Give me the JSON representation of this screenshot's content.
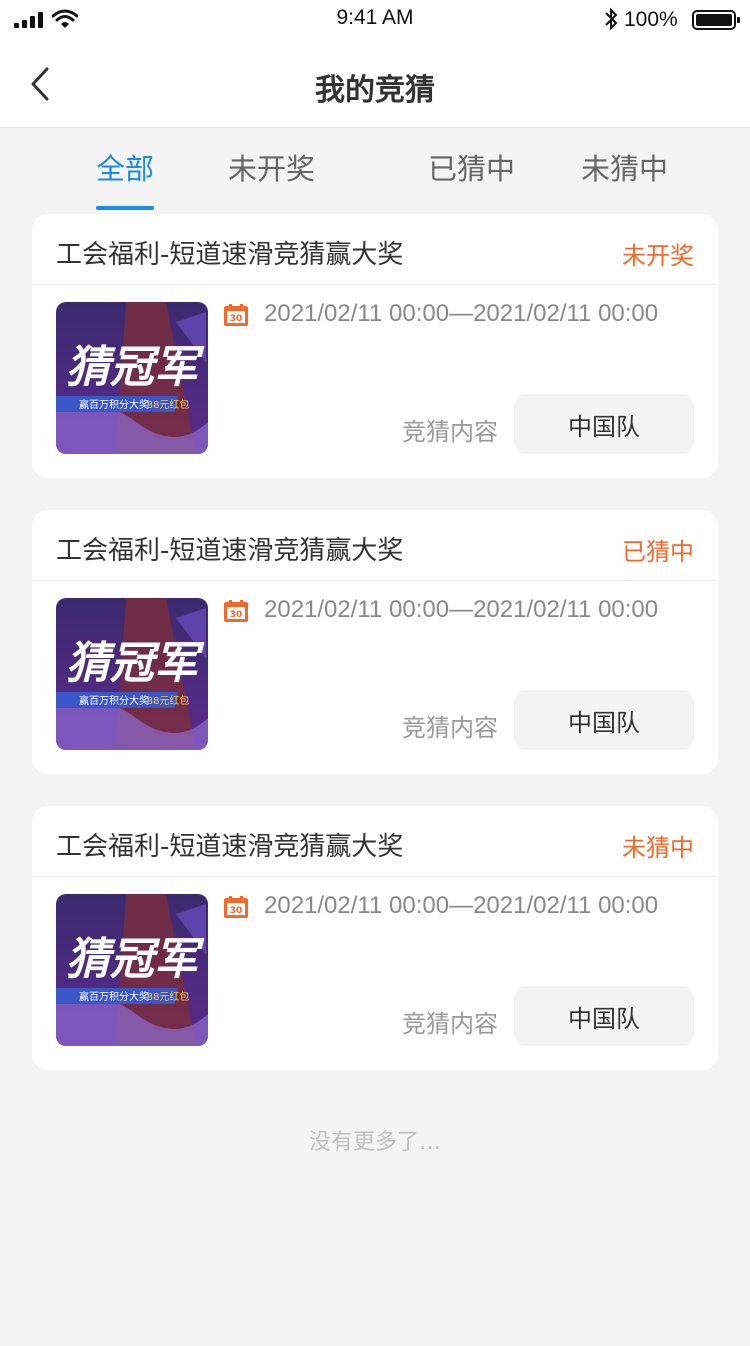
{
  "status_bar": {
    "time": "9:41 AM",
    "battery_percent": "100%"
  },
  "nav": {
    "title": "我的竞猜"
  },
  "tabs": [
    {
      "label": "全部",
      "active": true
    },
    {
      "label": "未开奖",
      "active": false
    },
    {
      "label": "已猜中",
      "active": false
    },
    {
      "label": "未猜中",
      "active": false
    }
  ],
  "cards": [
    {
      "title": "工会福利-短道速滑竞猜赢大奖",
      "status": "未开奖",
      "date_range": "2021/02/11 00:00—2021/02/11 00:00",
      "guess_label": "竞猜内容",
      "answer": "中国队",
      "calendar_day": "30",
      "thumb_title": "猜冠军",
      "thumb_banner": "赢百万积分大奖",
      "thumb_badge": "88元红包"
    },
    {
      "title": "工会福利-短道速滑竞猜赢大奖",
      "status": "已猜中",
      "date_range": "2021/02/11 00:00—2021/02/11 00:00",
      "guess_label": "竞猜内容",
      "answer": "中国队",
      "calendar_day": "30",
      "thumb_title": "猜冠军",
      "thumb_banner": "赢百万积分大奖",
      "thumb_badge": "88元红包"
    },
    {
      "title": "工会福利-短道速滑竞猜赢大奖",
      "status": "未猜中",
      "date_range": "2021/02/11 00:00—2021/02/11 00:00",
      "guess_label": "竞猜内容",
      "answer": "中国队",
      "calendar_day": "30",
      "thumb_title": "猜冠军",
      "thumb_banner": "赢百万积分大奖",
      "thumb_badge": "88元红包"
    }
  ],
  "footer": {
    "text": "没有更多了…"
  },
  "colors": {
    "accent": "#1a8ce8",
    "status": "#f06a2b"
  }
}
